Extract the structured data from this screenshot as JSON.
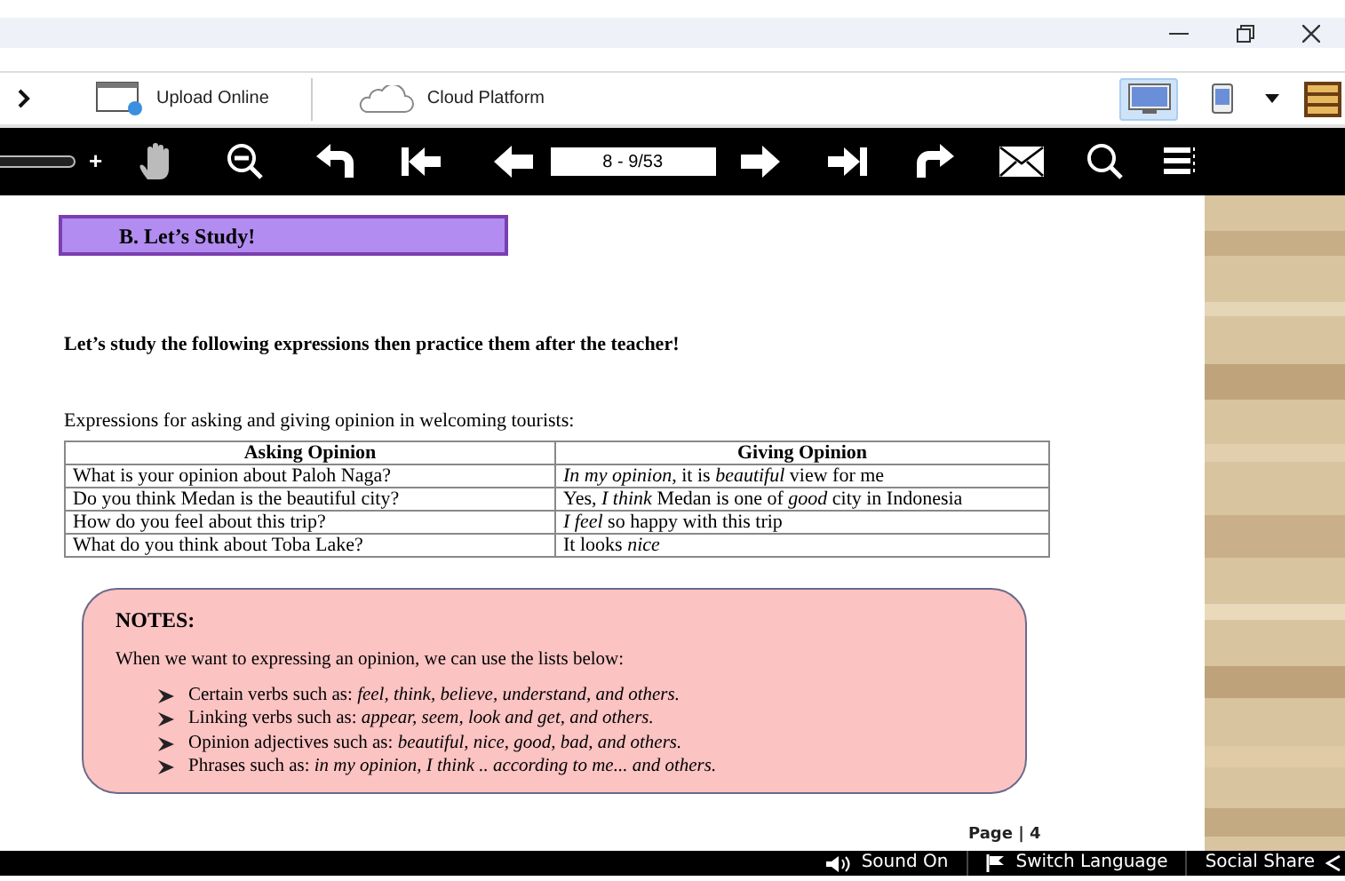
{
  "toolbar": {
    "buttons": [
      {
        "kind": "upload",
        "label": "Upload Online"
      },
      {
        "kind": "cloud",
        "label": "Cloud Platform"
      }
    ],
    "view_modes": [
      {
        "kind": "desktop",
        "selected": true
      },
      {
        "kind": "tablet",
        "selected": false
      }
    ]
  },
  "nav_bar": {
    "zoom_plus": "+",
    "page_field": "8 - 9/53"
  },
  "page": {
    "section_heading": "B.  Let’s Study!",
    "instruction": "Let’s study the following expressions then practice them after the teacher!",
    "intro": "Expressions for asking and giving opinion in welcoming tourists:",
    "table": {
      "columns": [
        "Asking Opinion",
        "Giving Opinion"
      ],
      "rows": [
        [
          "What is your opinion about Paloh Naga?",
          "*In my opinion*, it is *beautiful* view for me"
        ],
        [
          "Do you think Medan is the beautiful city?",
          "Yes, *I think* Medan is one of *good* city in Indonesia"
        ],
        [
          "How do you feel about this trip?",
          "*I feel* so happy with this trip"
        ],
        [
          "What do you think about Toba Lake?",
          "It looks *nice*"
        ]
      ]
    },
    "notes": {
      "title": "NOTES:",
      "intro": "When we want to expressing an opinion, we can use the lists below:",
      "items": [
        "Certain verbs such as: *feel, think, believe, understand, and others.*",
        "Linking verbs such as: *appear, seem, look and get, and others.*",
        "Opinion adjectives such as: *beautiful, nice, good, bad, and others.*",
        "Phrases such as: *in my opinion, I think .. according to me... and others.*"
      ]
    },
    "page_number": "Page | 4"
  },
  "bottom_bar": [
    {
      "kind": "sound",
      "label": "Sound On"
    },
    {
      "kind": "language",
      "label": "Switch Language"
    },
    {
      "kind": "share",
      "label": "Social Share"
    }
  ]
}
